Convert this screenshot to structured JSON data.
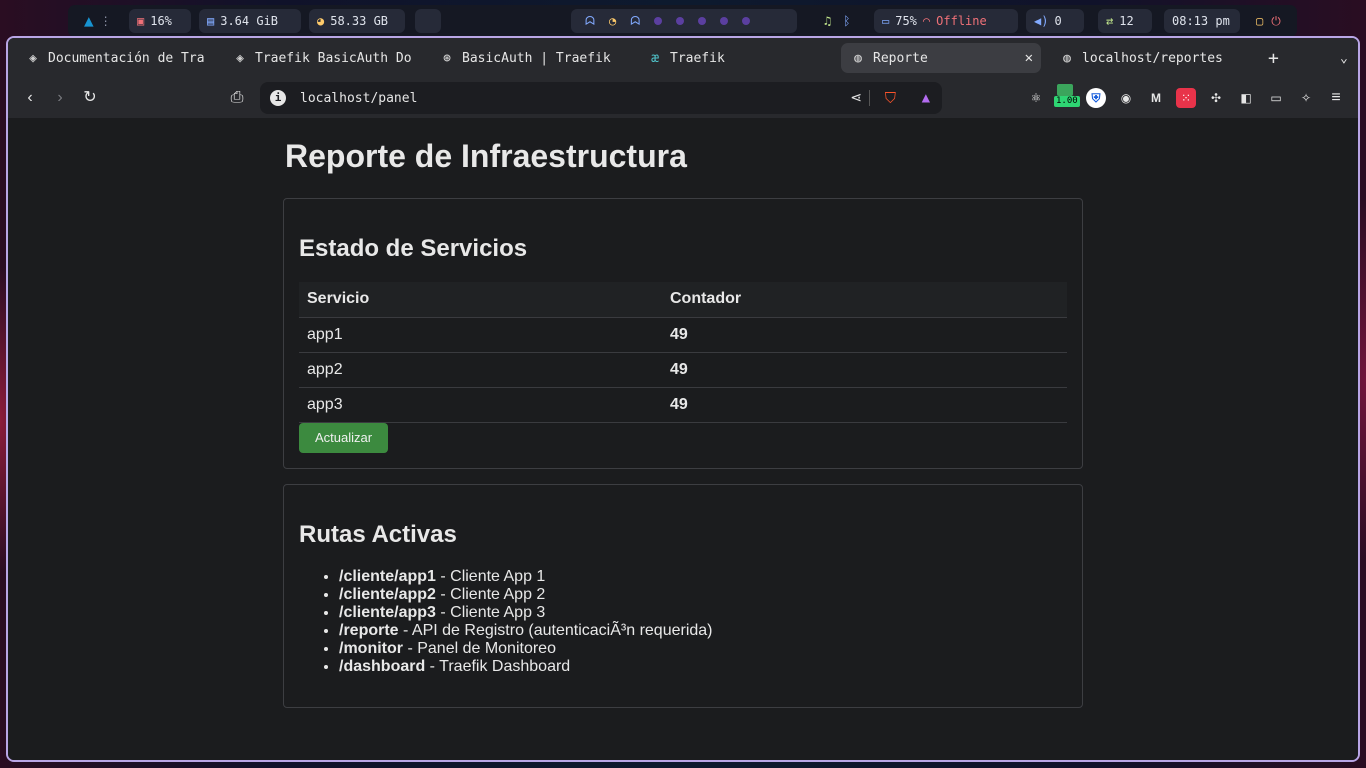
{
  "topbar": {
    "cpu": "16%",
    "ram": "3.64 GiB",
    "disk": "58.33 GB",
    "battery": "75%",
    "network": "Offline",
    "volume": "0",
    "updates": "12",
    "clock": "08:13 pm"
  },
  "tabs": [
    {
      "title": "Documentación de Tra"
    },
    {
      "title": "Traefik BasicAuth Do"
    },
    {
      "title": "BasicAuth | Traefik"
    },
    {
      "title": "Traefik"
    },
    {
      "title": "Reporte"
    },
    {
      "title": "localhost/reportes"
    }
  ],
  "address": "localhost/panel",
  "extension_badge": "1.00",
  "page": {
    "title": "Reporte de Infraestructura",
    "services": {
      "heading": "Estado de Servicios",
      "columns": [
        "Servicio",
        "Contador"
      ],
      "rows": [
        {
          "name": "app1",
          "count": "49"
        },
        {
          "name": "app2",
          "count": "49"
        },
        {
          "name": "app3",
          "count": "49"
        }
      ],
      "button": "Actualizar"
    },
    "routes": {
      "heading": "Rutas Activas",
      "items": [
        {
          "path": "/cliente/app1",
          "desc": " - Cliente App 1"
        },
        {
          "path": "/cliente/app2",
          "desc": " - Cliente App 2"
        },
        {
          "path": "/cliente/app3",
          "desc": " - Cliente App 3"
        },
        {
          "path": "/reporte",
          "desc": " - API de Registro (autenticaciÃ³n requerida)"
        },
        {
          "path": "/monitor",
          "desc": " - Panel de Monitoreo"
        },
        {
          "path": "/dashboard",
          "desc": " - Traefik Dashboard"
        }
      ]
    }
  },
  "colors": {
    "accent_green": "#3c8a3f",
    "window_border": "#b9a6e6",
    "offline_red": "#f07178"
  }
}
